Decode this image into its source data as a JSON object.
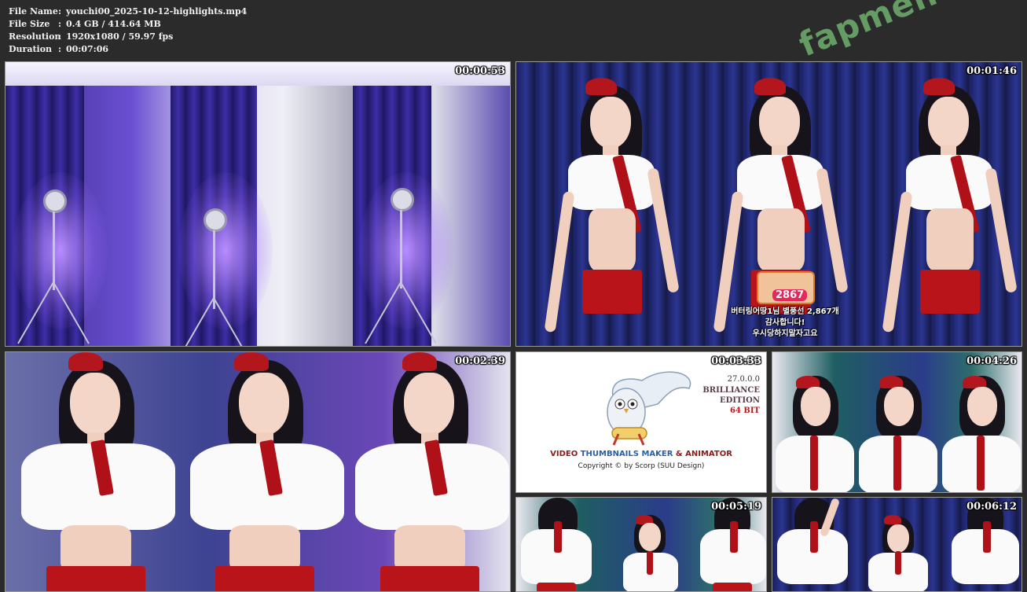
{
  "file_info": {
    "rows": [
      {
        "label": "File Name",
        "sep": ":",
        "value": "youchi00_2025-10-12-highlights.mp4"
      },
      {
        "label": "File Size",
        "sep": ":",
        "value": "0.4 GB / 414.64 MB"
      },
      {
        "label": "Resolution",
        "sep": ":",
        "value": "1920x1080 / 59.97 fps"
      },
      {
        "label": "Duration",
        "sep": ":",
        "value": "00:07:06"
      }
    ]
  },
  "thumbnails": [
    {
      "timestamp": "00:00:53"
    },
    {
      "timestamp": "00:01:46"
    },
    {
      "timestamp": "00:02:39"
    },
    {
      "timestamp": "00:03:33"
    },
    {
      "timestamp": "00:04:26"
    },
    {
      "timestamp": "00:05:19"
    },
    {
      "timestamp": "00:06:12"
    }
  ],
  "overlay": {
    "gift_count": "2867",
    "line1": "버터링어땅1님 별풍선 2,867개",
    "line2": "감사합니다!",
    "line3": "우시당하지말자고요"
  },
  "watermark": "fapmenu.com",
  "branding": {
    "version": "27.0.0.0",
    "edition": "BRILLIANCE EDITION",
    "bits": "64 BIT",
    "title_a": "VIDEO ",
    "title_b": "THUMBNAILS MAKER",
    "title_amp": " & ",
    "title_c": "ANIMATOR",
    "copyright": "Copyright © by Scorp (SUU Design)"
  },
  "colors": {
    "background": "#2b2b2b",
    "watermark": "#6fb06f"
  }
}
